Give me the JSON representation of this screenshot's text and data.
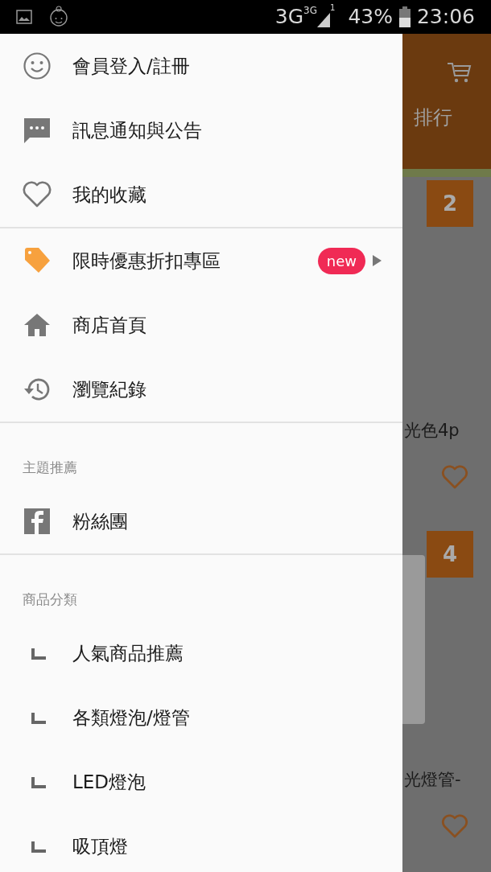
{
  "status_bar": {
    "network": "3G",
    "network_small": "3G",
    "sim": "1",
    "battery": "43%",
    "time": "23:06"
  },
  "background_app": {
    "tab_label": "排行",
    "cards": [
      {
        "rank": "2",
        "title": "光色4p"
      },
      {
        "rank": "4",
        "title": "光燈管-"
      }
    ]
  },
  "drawer": {
    "sections": [
      {
        "items": [
          {
            "kind": "smiley",
            "label": "會員登入/註冊"
          },
          {
            "kind": "chat",
            "label": "訊息通知與公告"
          },
          {
            "kind": "heart",
            "label": "我的收藏"
          }
        ]
      },
      {
        "items": [
          {
            "kind": "tag",
            "label": "限時優惠折扣專區",
            "badge": "new",
            "arrow": true
          },
          {
            "kind": "home",
            "label": "商店首頁"
          },
          {
            "kind": "history",
            "label": "瀏覽紀錄"
          }
        ]
      },
      {
        "header": "主題推薦",
        "items": [
          {
            "kind": "facebook",
            "label": "粉絲團"
          }
        ]
      },
      {
        "header": "商品分類",
        "items": [
          {
            "kind": "sub",
            "label": "人氣商品推薦"
          },
          {
            "kind": "sub",
            "label": "各類燈泡/燈管"
          },
          {
            "kind": "sub",
            "label": "LED燈泡"
          },
          {
            "kind": "sub",
            "label": "吸頂燈"
          }
        ]
      }
    ]
  }
}
